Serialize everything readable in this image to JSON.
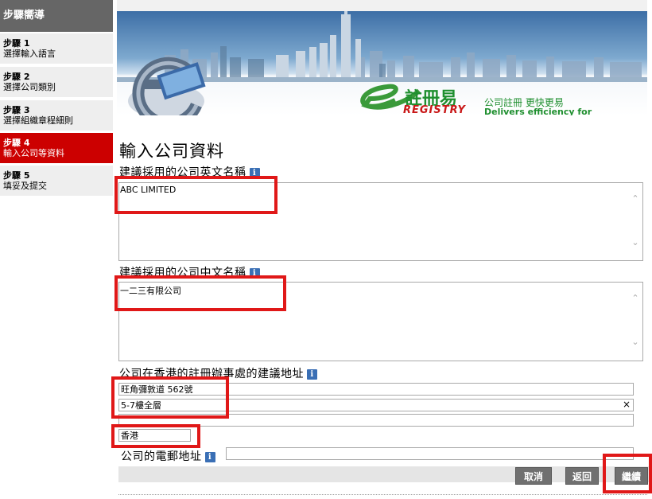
{
  "sidebar": {
    "title": "步驟嚮導",
    "steps": [
      {
        "num": "步驟 1",
        "label": "選擇輸入語言"
      },
      {
        "num": "步驟 2",
        "label": "選擇公司類別"
      },
      {
        "num": "步驟 3",
        "label": "選擇組織章程細則"
      },
      {
        "num": "步驟 4",
        "label": "輸入公司等資料"
      },
      {
        "num": "步驟 5",
        "label": "填妥及提交"
      }
    ]
  },
  "banner": {
    "logo_cn": "註冊易",
    "logo_en": "REGISTRY",
    "tagline_cn": "公司註冊 更快更易",
    "tagline_en": "Delivers efficiency for companies"
  },
  "form": {
    "page_title": "輸入公司資料",
    "english_name_label": "建議採用的公司英文名稱",
    "english_name_value": "ABC LIMITED",
    "chinese_name_label": "建議採用的公司中文名稱",
    "chinese_name_value": "一二三有限公司",
    "address_label": "公司在香港的註冊辦事處的建議地址",
    "address_line1": "旺角彌敦道 562號",
    "address_line2": "5-7樓全層",
    "address_line3": "",
    "region": "香港",
    "email_label": "公司的電郵地址",
    "email_value": "",
    "info_glyph": "i",
    "clear_glyph": "×"
  },
  "buttons": {
    "cancel": "取消",
    "back": "返回",
    "continue": "繼續"
  },
  "colors": {
    "active_step": "#cc0000",
    "highlight": "#e01818",
    "button": "#707070"
  }
}
